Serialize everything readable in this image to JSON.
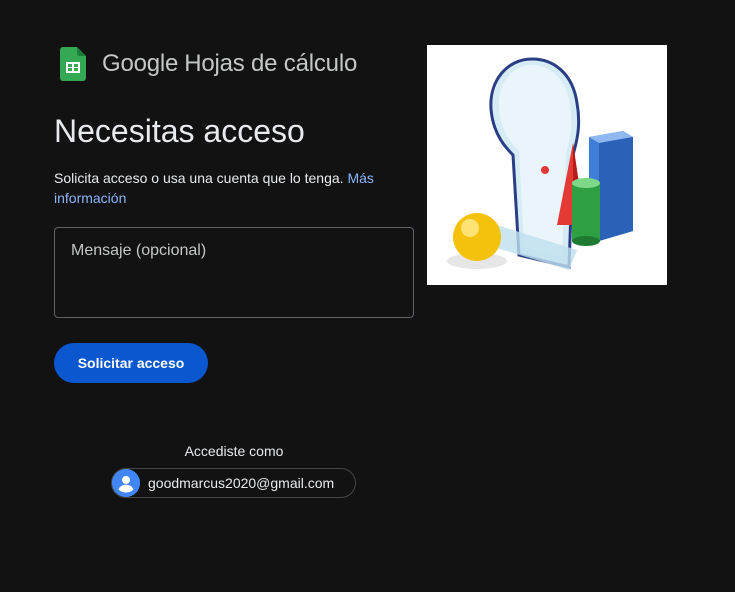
{
  "header": {
    "brand_google": "Google",
    "brand_product": "Hojas de cálculo",
    "icon": "google-sheets-icon",
    "sheets_color": "#34a853"
  },
  "main": {
    "title": "Necesitas acceso",
    "subtitle_text": "Solicita acceso o usa una cuenta que lo tenga.",
    "more_info_link": "Más información",
    "message_placeholder": "Mensaje (opcional)",
    "message_value": "",
    "request_button_label": "Solicitar acceso",
    "accent_color": "#0b57d0",
    "link_color": "#8ab4f8"
  },
  "account": {
    "signed_in_label": "Accediste como",
    "email": "goodmarcus2020@gmail.com",
    "avatar_icon": "account-circle-icon"
  },
  "illustration": {
    "icon": "keyhole-shapes-illustration"
  }
}
